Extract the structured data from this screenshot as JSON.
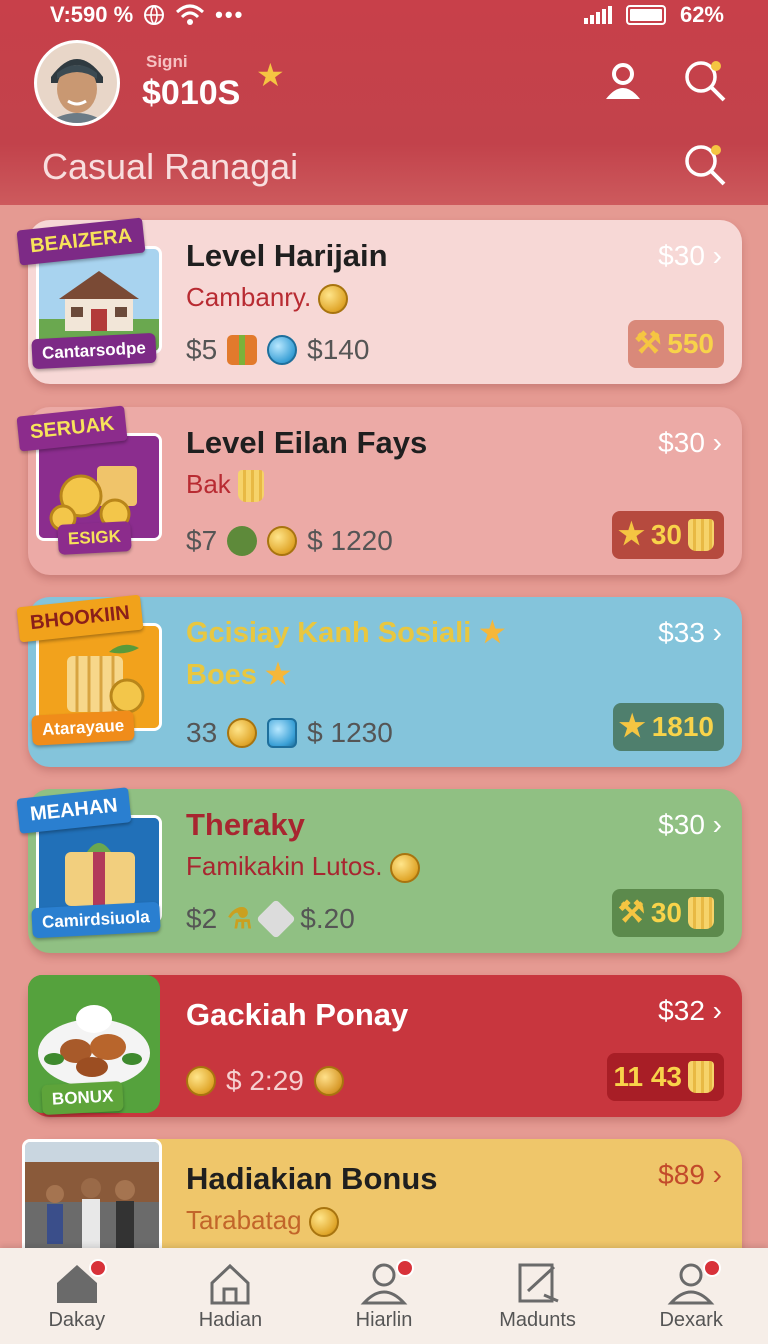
{
  "status_bar": {
    "left_text": "V:590 %",
    "battery_text": "62%"
  },
  "profile": {
    "sub_label": "Signi",
    "balance": "$010S"
  },
  "page_title": "Casual Ranagai",
  "cards": [
    {
      "ribbon": "BEAIZERA",
      "ribbon_bottom": "Cantarsodpe",
      "title": "Level Harijain",
      "subtitle": "Cambanry.",
      "price": "$30",
      "stat_left": "$5",
      "stat_right": "$140",
      "badge": "550",
      "color": "#f7d8d6"
    },
    {
      "ribbon": "SERUAK",
      "ribbon_bottom": "ESIGK",
      "title": "Level Eilan Fays",
      "subtitle": "Bak",
      "price": "$30",
      "stat_left": "$7",
      "stat_right": "$ 1220",
      "badge": "30",
      "color": "#ecaaa6"
    },
    {
      "ribbon": "BHOOKIIN",
      "ribbon_bottom": "Atarayaue",
      "title": "Gcisiay Kanh Sosiali",
      "subtitle": "Boes",
      "price": "$33",
      "stat_left": "33",
      "stat_right": "$ 1230",
      "badge": "1810",
      "color": "#84c4db"
    },
    {
      "ribbon": "MEAHAN",
      "ribbon_bottom": "Camirdsiuola",
      "title": "Theraky",
      "subtitle": "Famikakin Lutos.",
      "price": "$30",
      "stat_left": "$2",
      "stat_right": "$.20",
      "badge": "30",
      "color": "#90c083"
    },
    {
      "ribbon": "",
      "ribbon_bottom": "BONUX",
      "title": "Gackiah Ponay",
      "subtitle": "",
      "price": "$32",
      "stat_left": "",
      "stat_right": "$ 2:29",
      "badge": "11 43",
      "color": "#c8363e"
    },
    {
      "ribbon": "",
      "ribbon_bottom": "",
      "title": "Hadiakian Bonus",
      "subtitle": "Tarabatag",
      "price": "$89",
      "stat_left": "",
      "stat_right": "",
      "badge": "",
      "color": "#efc66a"
    }
  ],
  "nav": [
    {
      "label": "Dakay",
      "icon": "home-icon"
    },
    {
      "label": "Hadian",
      "icon": "house-outline-icon"
    },
    {
      "label": "Hiarlin",
      "icon": "person-icon"
    },
    {
      "label": "Madunts",
      "icon": "edit-icon"
    },
    {
      "label": "Dexark",
      "icon": "profile-icon"
    }
  ]
}
